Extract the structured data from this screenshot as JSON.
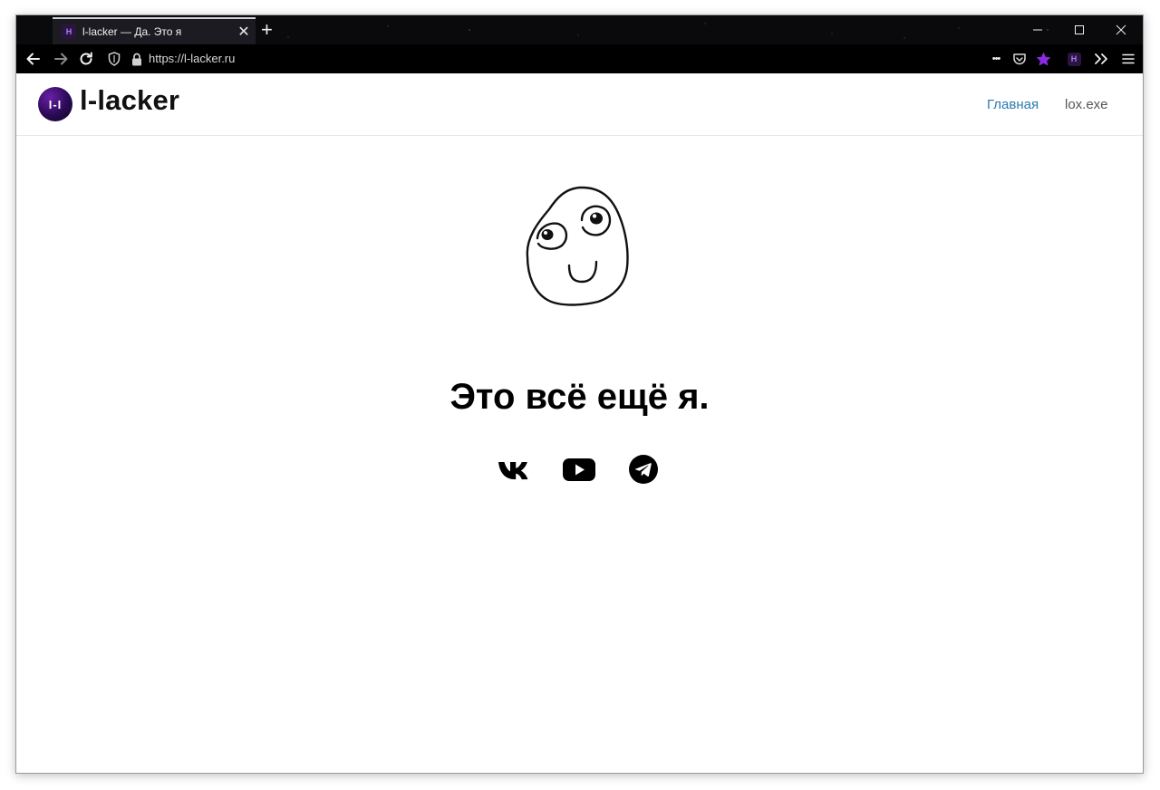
{
  "browser": {
    "tab": {
      "favicon_text": "H",
      "title": "l-lacker — Да. Это я",
      "close_label": "✕"
    },
    "new_tab_label": "+",
    "window_controls": {
      "minimize": "–",
      "maximize": "☐",
      "close": "✕"
    },
    "nav": {
      "back_icon": "arrow-left-icon",
      "forward_icon": "arrow-right-icon",
      "reload_icon": "reload-icon",
      "url": "https://l-lacker.ru",
      "more_label": "•••",
      "extension_label": "H"
    },
    "colors": {
      "star": "#8a2be2",
      "tab_bg": "#1c1b22",
      "toolbar_bg": "#000000"
    }
  },
  "site": {
    "logo": {
      "mark_text": "I-I",
      "name": "l-lacker"
    },
    "nav": [
      {
        "label": "Главная",
        "active": true
      },
      {
        "label": "lox.exe",
        "active": false
      }
    ],
    "colors": {
      "active_link": "#2a7ab0",
      "link": "#555555"
    },
    "headline": "Это всё ещё я.",
    "avatar": "derp-face-drawing",
    "social": [
      {
        "name": "vk-icon"
      },
      {
        "name": "youtube-icon"
      },
      {
        "name": "telegram-icon"
      }
    ]
  }
}
